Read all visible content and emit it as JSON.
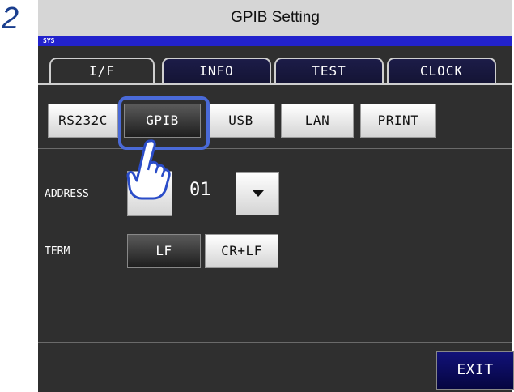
{
  "step_number": "2",
  "title": "GPIB Setting",
  "sys_label": "SYS",
  "tabs": [
    {
      "label": "I/F",
      "active": true
    },
    {
      "label": "INFO",
      "active": false
    },
    {
      "label": "TEST",
      "active": false
    },
    {
      "label": "CLOCK",
      "active": false
    }
  ],
  "interfaces": [
    {
      "label": "RS232C",
      "selected": false
    },
    {
      "label": "GPIB",
      "selected": true
    },
    {
      "label": "USB",
      "selected": false
    },
    {
      "label": "LAN",
      "selected": false
    },
    {
      "label": "PRINT",
      "selected": false
    }
  ],
  "address": {
    "label": "ADDRESS",
    "value": "01"
  },
  "term": {
    "label": "TERM",
    "options": [
      {
        "label": "LF",
        "selected": true
      },
      {
        "label": "CR+LF",
        "selected": false
      }
    ]
  },
  "exit_label": "EXIT",
  "colors": {
    "accent": "#4a6ad8",
    "sysbar": "#2222cc",
    "screen": "#2f2f2f",
    "step": "#1a3e8e"
  },
  "icons": {
    "pointer": "pointing-hand-icon",
    "down": "triangle-down-icon"
  }
}
